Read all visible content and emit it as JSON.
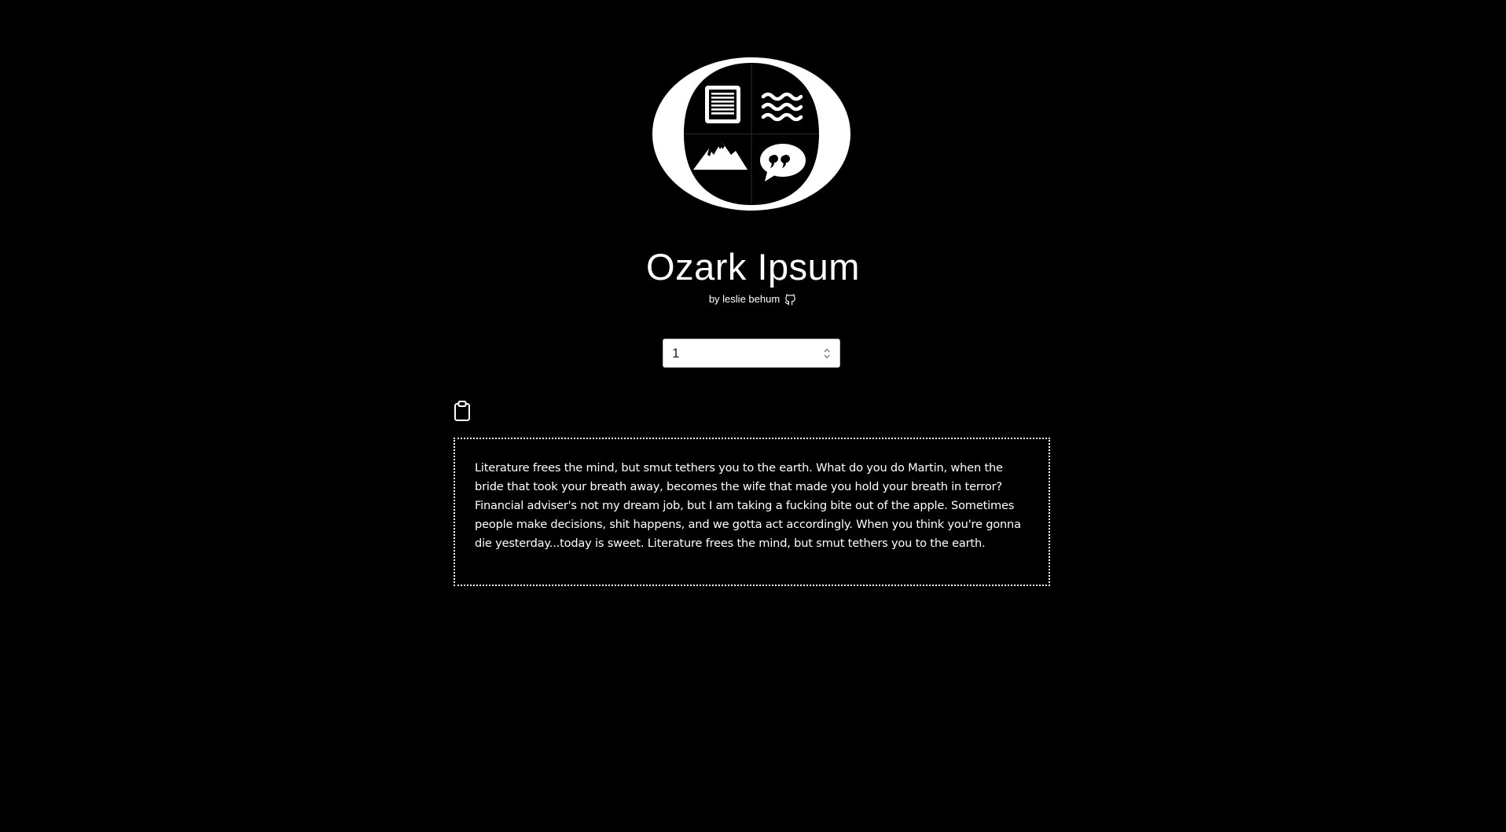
{
  "header": {
    "logo_icon": "ozark-ipsum-logo-icon",
    "title": "Ozark Ipsum",
    "byline": "by leslie behum",
    "github_icon": "github-icon"
  },
  "controls": {
    "paragraph_count": "1",
    "copy_icon": "clipboard-icon"
  },
  "output": {
    "text": "Literature frees the mind, but smut tethers you to the earth. What do you do Martin, when the bride that took your breath away, becomes the wife that made you hold your breath in terror? Financial adviser's not my dream job, but I am taking a fucking bite out of the apple. Sometimes people make decisions, shit happens, and we gotta act accordingly. When you think you're gonna die yesterday...today is sweet. Literature frees the mind, but smut tethers you to the earth."
  },
  "colors": {
    "background": "#000000",
    "foreground": "#ffffff"
  }
}
